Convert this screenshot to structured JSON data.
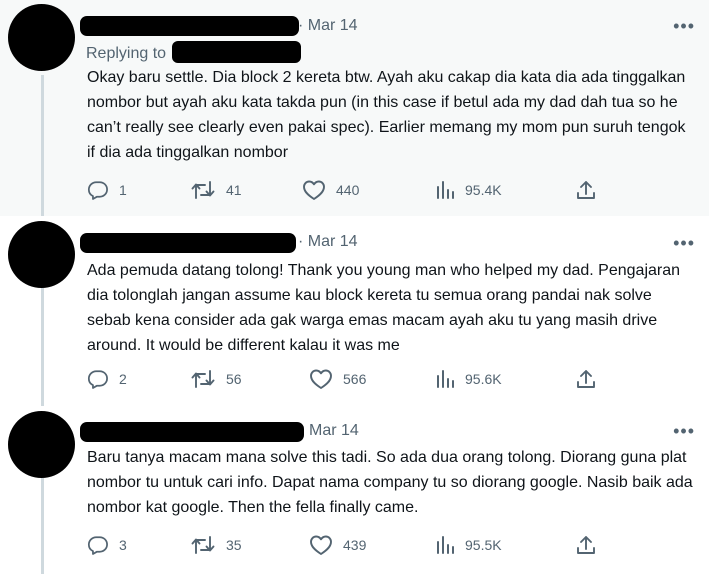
{
  "tweets": [
    {
      "date": "· Mar 14",
      "replying_to": "Replying to",
      "text": "Okay baru settle. Dia block 2 kereta btw. Ayah aku cakap dia kata dia ada tinggalkan nombor but ayah aku kata takda pun (in this case if betul ada my dad dah tua so he can’t really see clearly even pakai spec). Earlier memang my mom pun suruh tengok if dia ada tinggalkan nombor",
      "replies": "1",
      "retweets": "41",
      "likes": "440",
      "views": "95.4K"
    },
    {
      "date": "· Mar 14",
      "text": "Ada pemuda datang tolong! Thank you young man who helped my dad. Pengajaran dia tolonglah jangan assume kau block kereta tu semua orang pandai nak solve sebab kena consider ada gak warga emas macam ayah aku tu yang masih drive around. It would be different kalau it was me",
      "replies": "2",
      "retweets": "56",
      "likes": "566",
      "views": "95.6K"
    },
    {
      "date": "Mar 14",
      "text": "Baru tanya macam mana solve this tadi. So ada dua orang tolong. Diorang guna plat nombor tu untuk cari info. Dapat nama company tu so diorang google. Nasib baik ada nombor kat google. Then the fella finally came.",
      "replies": "3",
      "retweets": "35",
      "likes": "439",
      "views": "95.5K"
    }
  ],
  "colors": {
    "highlight_bg": "#f7f9f9",
    "muted": "#536471",
    "thread_line": "#cfd9de",
    "text": "#0f1419"
  },
  "icons": [
    "reply-icon",
    "retweet-icon",
    "like-icon",
    "views-icon",
    "share-icon",
    "more-icon"
  ]
}
